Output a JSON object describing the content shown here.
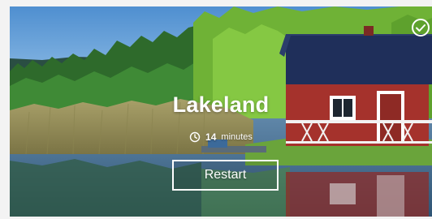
{
  "card": {
    "title": "Lakeland",
    "duration_value": "14",
    "duration_unit": "minutes",
    "restart_label": "Restart",
    "completed_icon": "check-circle-icon",
    "clock_icon": "clock-icon"
  },
  "colors": {
    "sky": "#6fa7d6",
    "forest": "#2f6a2c",
    "cabin_red": "#a5322c",
    "roof": "#1f2f5a",
    "text": "#ffffff"
  }
}
